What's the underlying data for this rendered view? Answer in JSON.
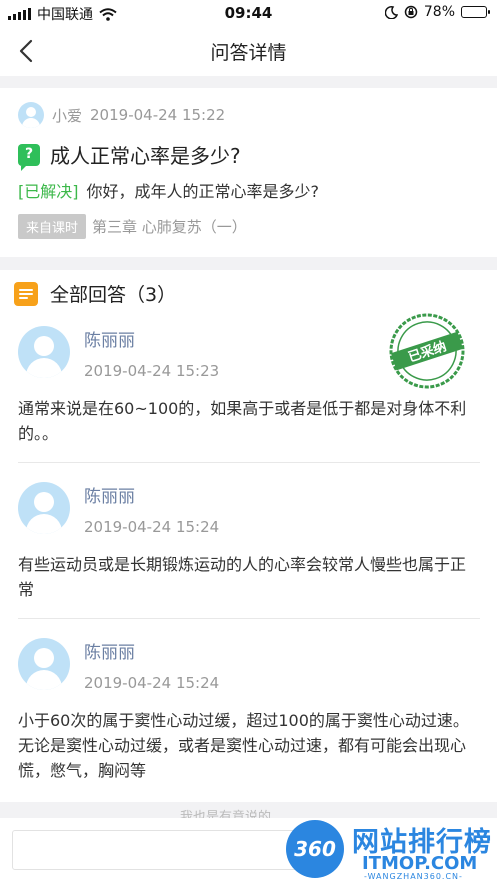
{
  "status_bar": {
    "carrier": "中国联通",
    "time": "09:44",
    "battery": "78%",
    "battery_level": 0.78
  },
  "nav": {
    "title": "问答详情"
  },
  "question": {
    "asker_name": "小爱",
    "asked_at": "2019-04-24 15:22",
    "badge": "?",
    "title": "成人正常心率是多少?",
    "status": "[已解决]",
    "content": "你好，成年人的正常心率是多少?",
    "source_tag": "来自课时",
    "source_text": "第三章  心肺复苏（一）"
  },
  "answers_section": {
    "header": "全部回答（3）",
    "items": [
      {
        "name": "陈丽丽",
        "time": "2019-04-24 15:23",
        "text": "通常来说是在60~100的，如果高于或者是低于都是对身体不利的。。",
        "adopted": true
      },
      {
        "name": "陈丽丽",
        "time": "2019-04-24 15:24",
        "text": "有些运动员或是长期锻炼运动的人的心率会较常人慢些也属于正常",
        "adopted": false
      },
      {
        "name": "陈丽丽",
        "time": "2019-04-24 15:24",
        "text": "小于60次的属于窦性心动过缓，超过100的属于窦性心动过速。无论是窦性心动过缓，或者是窦性心动过速，都有可能会出现心慌，憋气，胸闷等",
        "adopted": false
      }
    ]
  },
  "stamp": {
    "label": "已采纳"
  },
  "bottom": {
    "hint": "我也是有意说的"
  },
  "watermark": {
    "badge": "360",
    "brand": "网站排行榜",
    "site": "ITMOP.COM",
    "sub": "-WANGZHAN360.CN-"
  },
  "colors": {
    "accent_green": "#3cb84a",
    "name_blue": "#6b7fa3",
    "header_orange": "#f7a11a",
    "stamp_green": "#3a9a4a",
    "watermark_blue": "#2b86e0"
  },
  "icons": {
    "back": "chevron-left-icon",
    "question": "question-badge-icon",
    "answers": "list-icon",
    "wifi": "wifi-icon",
    "moon": "moon-icon",
    "lock": "rotation-lock-icon",
    "battery": "battery-icon"
  }
}
